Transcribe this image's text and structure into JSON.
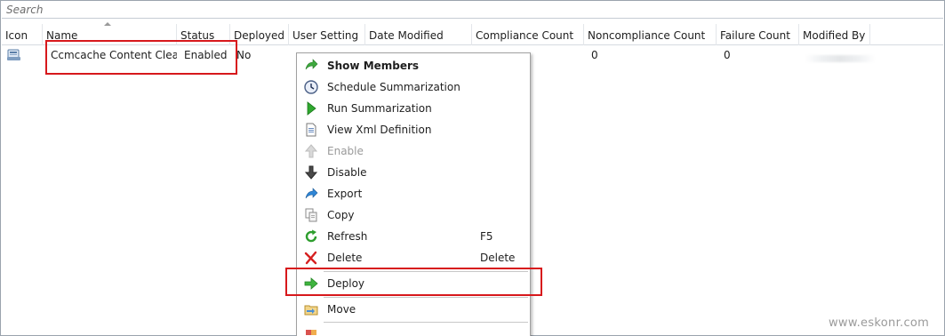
{
  "search": {
    "placeholder": "Search"
  },
  "columns": [
    "Icon",
    "Name",
    "Status",
    "Deployed",
    "User Setting",
    "Date Modified",
    "Compliance Count",
    "Noncompliance Count",
    "Failure Count",
    "Modified By"
  ],
  "row": {
    "name": "Ccmcache Content Clea...",
    "status": "Enabled",
    "deployed": "No",
    "noncompliance_count": "0",
    "failure_count": "0",
    "icon": "configuration-item-icon"
  },
  "menu": {
    "items": [
      {
        "label": "Show Members",
        "icon": "arrow-green-icon",
        "bold": true
      },
      {
        "label": "Schedule Summarization",
        "icon": "clock-icon"
      },
      {
        "label": "Run Summarization",
        "icon": "play-icon"
      },
      {
        "label": "View Xml Definition",
        "icon": "document-icon"
      },
      {
        "label": "Enable",
        "icon": "arrow-up-icon",
        "disabled": true
      },
      {
        "label": "Disable",
        "icon": "arrow-down-icon"
      },
      {
        "label": "Export",
        "icon": "export-arrow-icon"
      },
      {
        "label": "Copy",
        "icon": "copy-icon"
      },
      {
        "label": "Refresh",
        "icon": "refresh-icon",
        "shortcut": "F5"
      },
      {
        "label": "Delete",
        "icon": "delete-x-icon",
        "shortcut": "Delete"
      },
      {
        "label": "Deploy",
        "icon": "deploy-arrow-icon"
      },
      {
        "label": "Move",
        "icon": "folder-icon"
      }
    ]
  },
  "watermark": "www.eskonr.com",
  "colors": {
    "highlight": "#d7181c",
    "accent_green": "#2e9e2e",
    "accent_blue": "#2a7fd4"
  }
}
